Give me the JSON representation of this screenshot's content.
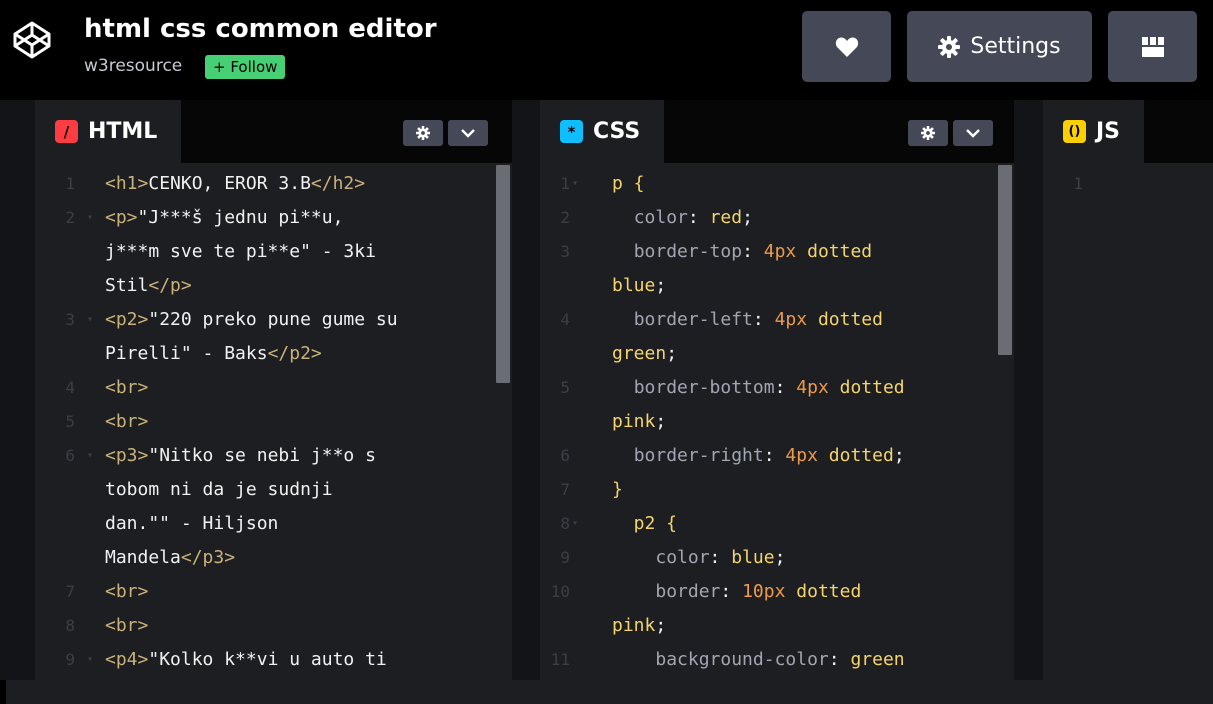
{
  "header": {
    "title": "html css common editor",
    "owner": "w3resource",
    "follow_label": "+ Follow",
    "settings_label": "Settings",
    "icons": {
      "logo": "codepen-logo-icon",
      "heart": "heart-icon",
      "gear": "gear-icon",
      "layout": "layout-icon"
    }
  },
  "colors": {
    "follow": "#47cf73",
    "html_icon": "#ff3c41",
    "css_icon": "#0ebeff",
    "js_icon": "#fcd000",
    "button": "#444857"
  },
  "panes": {
    "html": {
      "label": "HTML",
      "icon_glyph": "/",
      "lines": [
        {
          "n": "1",
          "text": "<h1>CENKO, EROR 3.B</h2>"
        },
        {
          "n": "2",
          "text": "<p>\"J***š jednu pi**u,"
        },
        {
          "n": "",
          "text": "j***m sve te pi**e\" - 3ki"
        },
        {
          "n": "",
          "text": "Stil</p>"
        },
        {
          "n": "3",
          "text": "<p2>\"220 preko pune gume su"
        },
        {
          "n": "",
          "text": "Pirelli\" - Baks</p2>"
        },
        {
          "n": "4",
          "text": "<br>"
        },
        {
          "n": "5",
          "text": "<br>"
        },
        {
          "n": "6",
          "text": "<p3>\"Nitko se nebi j**o s"
        },
        {
          "n": "",
          "text": "tobom ni da je sudnji"
        },
        {
          "n": "",
          "text": "dan.\"\" - Hiljson"
        },
        {
          "n": "",
          "text": "Mandela</p3>"
        },
        {
          "n": "7",
          "text": "<br>"
        },
        {
          "n": "8",
          "text": "<br>"
        },
        {
          "n": "9",
          "text": "<p4>\"Kolko k**vi u auto ti"
        }
      ]
    },
    "css": {
      "label": "CSS",
      "icon_glyph": "*",
      "lines": [
        {
          "n": "1",
          "text": "p {"
        },
        {
          "n": "2",
          "text": "  color: red;"
        },
        {
          "n": "3",
          "text": "  border-top: 4px dotted"
        },
        {
          "n": "",
          "text": "blue;"
        },
        {
          "n": "4",
          "text": "  border-left: 4px dotted"
        },
        {
          "n": "",
          "text": "green;"
        },
        {
          "n": "5",
          "text": "  border-bottom: 4px dotted"
        },
        {
          "n": "",
          "text": "pink;"
        },
        {
          "n": "6",
          "text": "  border-right: 4px dotted;"
        },
        {
          "n": "7",
          "text": "}"
        },
        {
          "n": "8",
          "text": "  p2 {"
        },
        {
          "n": "9",
          "text": "    color: blue;"
        },
        {
          "n": "10",
          "text": "    border: 10px dotted"
        },
        {
          "n": "",
          "text": "pink;"
        },
        {
          "n": "11",
          "text": "    background-color: green"
        }
      ]
    },
    "js": {
      "label": "JS",
      "icon_glyph": "()",
      "lines": [
        {
          "n": "1",
          "text": ""
        }
      ]
    }
  }
}
